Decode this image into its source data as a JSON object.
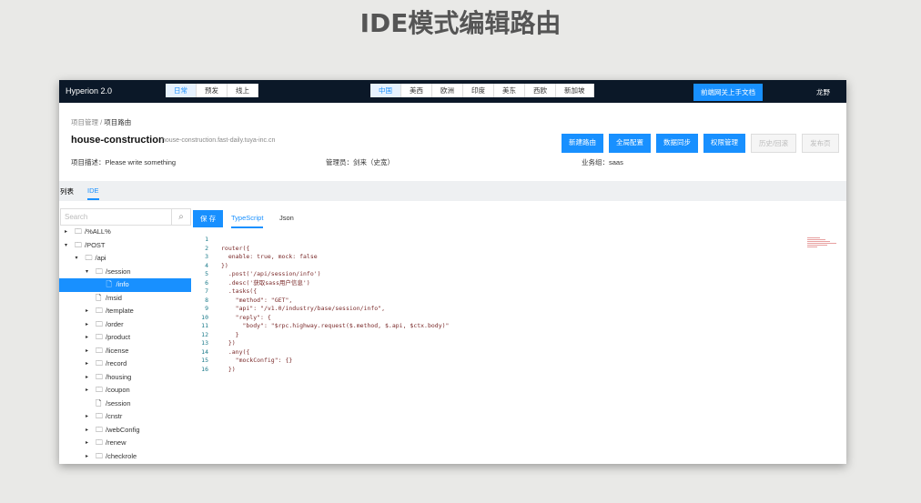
{
  "page_title": "IDE模式编辑路由",
  "header": {
    "brand": "Hyperion 2.0",
    "envs": [
      "日常",
      "预发",
      "线上"
    ],
    "env_active": 0,
    "regions": [
      "中国",
      "美西",
      "欧洲",
      "印度",
      "美东",
      "西欧",
      "新加坡"
    ],
    "region_active": 0,
    "docs_button": "前端网关上手文档",
    "user": "龙野"
  },
  "breadcrumb": {
    "parent": "项目管理",
    "sep": "/",
    "current": "项目路由"
  },
  "project": {
    "name": "house-construction",
    "host": "house-construction.fast-daily.tuya-inc.cn",
    "actions": [
      "新建路由",
      "全局配置",
      "数据同步",
      "权限管理"
    ],
    "disabled_actions": [
      "历史/回滚",
      "发布页"
    ],
    "desc": "项目描述：Please write something",
    "admin": "管理员：剑来（史宽）",
    "group": "业务组：saas"
  },
  "tabs": [
    "列表",
    "IDE"
  ],
  "search": {
    "placeholder": "Search"
  },
  "editor": {
    "save": "保 存",
    "tabs": [
      "TypeScript",
      "Json"
    ]
  },
  "tree": [
    {
      "label": "/%ALL%",
      "level": 0,
      "type": "folder",
      "arrow": "▸"
    },
    {
      "label": "/POST",
      "level": 0,
      "type": "folder-open",
      "arrow": "▾"
    },
    {
      "label": "/api",
      "level": 1,
      "type": "folder-open",
      "arrow": "▾"
    },
    {
      "label": "/session",
      "level": 2,
      "type": "folder-open",
      "arrow": "▾"
    },
    {
      "label": "/info",
      "level": 3,
      "type": "file",
      "selected": true
    },
    {
      "label": "/msid",
      "level": 2,
      "type": "file"
    },
    {
      "label": "/template",
      "level": 2,
      "type": "folder",
      "arrow": "▸"
    },
    {
      "label": "/order",
      "level": 2,
      "type": "folder",
      "arrow": "▸"
    },
    {
      "label": "/product",
      "level": 2,
      "type": "folder",
      "arrow": "▸"
    },
    {
      "label": "/license",
      "level": 2,
      "type": "folder",
      "arrow": "▸"
    },
    {
      "label": "/record",
      "level": 2,
      "type": "folder",
      "arrow": "▸"
    },
    {
      "label": "/housing",
      "level": 2,
      "type": "folder",
      "arrow": "▸"
    },
    {
      "label": "/coupon",
      "level": 2,
      "type": "folder",
      "arrow": "▸"
    },
    {
      "label": "/session",
      "level": 2,
      "type": "file"
    },
    {
      "label": "/cnstr",
      "level": 2,
      "type": "folder",
      "arrow": "▸"
    },
    {
      "label": "/webConfig",
      "level": 2,
      "type": "folder",
      "arrow": "▸"
    },
    {
      "label": "/renew",
      "level": 2,
      "type": "folder",
      "arrow": "▸"
    },
    {
      "label": "/checkrole",
      "level": 2,
      "type": "folder",
      "arrow": "▸"
    }
  ],
  "code": [
    "",
    "router({",
    "  enable: true, mock: false",
    "})",
    "  .post('/api/session/info')",
    "  .desc('获取sass用户信息')",
    "  .tasks({",
    "    \"method\": \"GET\",",
    "    \"api\": \"/v1.0/industry/base/session/info\",",
    "    \"reply\": {",
    "      \"body\": \"$rpc.highway.request($.method, $.api, $ctx.body)\"",
    "    }",
    "  })",
    "  .any({",
    "    \"mockConfig\": {}",
    "  })"
  ]
}
